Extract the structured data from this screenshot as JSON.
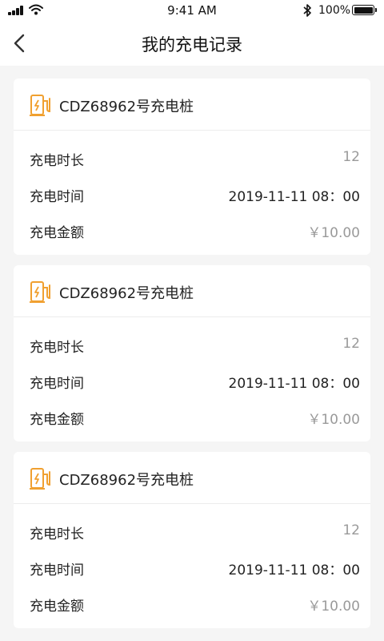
{
  "status_bar": {
    "time": "9:41 AM",
    "battery_text": "100%",
    "bluetooth_glyph": "∗"
  },
  "nav": {
    "title": "我的充电记录",
    "back_icon": "chevron-left-icon"
  },
  "colors": {
    "accent": "#f0a030",
    "muted_text": "#9a9a9a",
    "background": "#f5f5f5"
  },
  "records": [
    {
      "pile_name": "CDZ68962号充电桩",
      "duration_label": "充电时长",
      "duration_value": "12",
      "time_label": "充电时间",
      "time_value": "2019-11-11 08：00",
      "amount_label": "充电金额",
      "amount_value": "￥10.00"
    },
    {
      "pile_name": "CDZ68962号充电桩",
      "duration_label": "充电时长",
      "duration_value": "12",
      "time_label": "充电时间",
      "time_value": "2019-11-11 08：00",
      "amount_label": "充电金额",
      "amount_value": "￥10.00"
    },
    {
      "pile_name": "CDZ68962号充电桩",
      "duration_label": "充电时长",
      "duration_value": "12",
      "time_label": "充电时间",
      "time_value": "2019-11-11 08：00",
      "amount_label": "充电金额",
      "amount_value": "￥10.00"
    }
  ]
}
